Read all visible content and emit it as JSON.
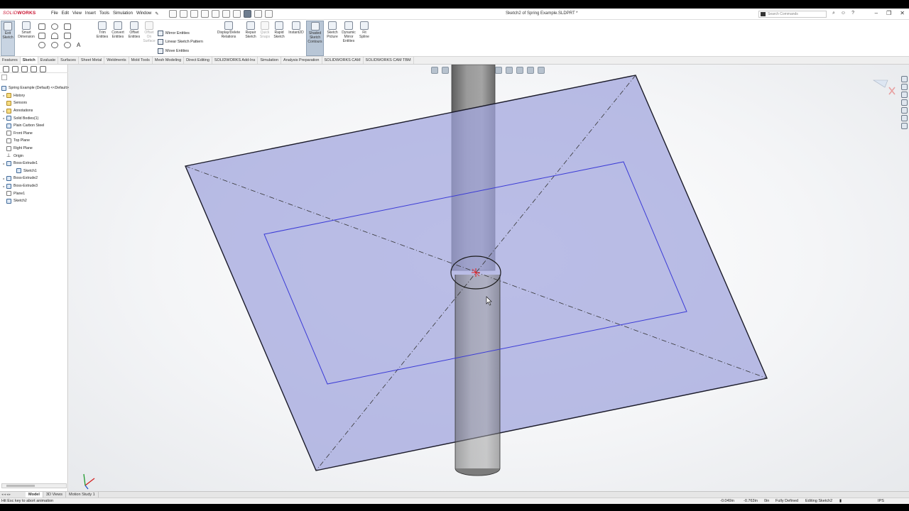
{
  "app": {
    "logo_brand": "SOLID",
    "logo_suffix": "WORKS",
    "document_title": "Sketch2 of Spring Example.SLDPRT *",
    "search_placeholder": "Search Commands"
  },
  "menu": [
    "File",
    "Edit",
    "View",
    "Insert",
    "Tools",
    "Simulation",
    "Window"
  ],
  "ribbon": {
    "exit_sketch": "Exit Sketch",
    "smart_dimension": "Smart Dimension",
    "trim_entities": "Trim Entities",
    "convert_entities": "Convert Entities",
    "offset_entities": "Offset Entities",
    "offset_on_surface": "Offset On Surface",
    "mirror_entities": "Mirror Entities",
    "linear_sketch_pattern": "Linear Sketch Pattern",
    "move_entities": "Move Entities",
    "display_delete_relations": "Display/Delete Relations",
    "repair_sketch": "Repair Sketch",
    "quick_snaps": "Quick Snaps",
    "rapid_sketch": "Rapid Sketch",
    "instant2d": "Instant2D",
    "shaded_sketch_contours": "Shaded Sketch Contours",
    "sketch_picture": "Sketch Picture",
    "dynamic_mirror": "Dynamic Mirror Entities",
    "fit_spline": "Fit Spline"
  },
  "command_tabs": [
    "Features",
    "Sketch",
    "Evaluate",
    "Surfaces",
    "Sheet Metal",
    "Weldments",
    "Mold Tools",
    "Mesh Modeling",
    "Direct Editing",
    "SOLIDWORKS Add-Ins",
    "Simulation",
    "Analysis Preparation",
    "SOLIDWORKS CAM",
    "SOLIDWORKS CAM TBM"
  ],
  "active_command_tab": "Sketch",
  "tree": {
    "root": "Spring Example (Default) <<Default>_Displ",
    "items": [
      {
        "label": "History",
        "icon": "history-icon",
        "expand": true
      },
      {
        "label": "Sensors",
        "icon": "sensor-icon",
        "expand": false
      },
      {
        "label": "Annotations",
        "icon": "annotation-icon",
        "expand": true
      },
      {
        "label": "Solid Bodies(1)",
        "icon": "solid-bodies-icon",
        "expand": true
      },
      {
        "label": "Plain Carbon Steel",
        "icon": "material-icon",
        "expand": false
      },
      {
        "label": "Front Plane",
        "icon": "plane-icon",
        "expand": false
      },
      {
        "label": "Top Plane",
        "icon": "plane-icon",
        "expand": false
      },
      {
        "label": "Right Plane",
        "icon": "plane-icon",
        "expand": false
      },
      {
        "label": "Origin",
        "icon": "origin-icon",
        "expand": false
      },
      {
        "label": "Boss-Extrude1",
        "icon": "extrude-icon",
        "expand": true
      },
      {
        "label": "Sketch1",
        "icon": "sketch-icon",
        "expand": false,
        "indent": true
      },
      {
        "label": "Boss-Extrude2",
        "icon": "extrude-icon",
        "expand": true
      },
      {
        "label": "Boss-Extrude3",
        "icon": "extrude-icon",
        "expand": true
      },
      {
        "label": "Plane1",
        "icon": "plane-icon",
        "expand": false
      },
      {
        "label": "Sketch2",
        "icon": "sketch-icon",
        "expand": false
      }
    ]
  },
  "bottom_tabs": [
    "Model",
    "3D Views",
    "Motion Study 1"
  ],
  "active_bottom_tab": "Model",
  "status": {
    "message": "Hit Esc key to abort animation",
    "x": "-0.049in",
    "y": "-0.763in",
    "z": "0in",
    "state": "Fully Defined",
    "editing": "Editing Sketch2",
    "units": "IPS"
  },
  "colors": {
    "plane_fill": "#9fa3dc",
    "sketch_line": "#3b3bd6",
    "cylinder": "#8a8a8a",
    "origin_mark": "#e02020"
  }
}
